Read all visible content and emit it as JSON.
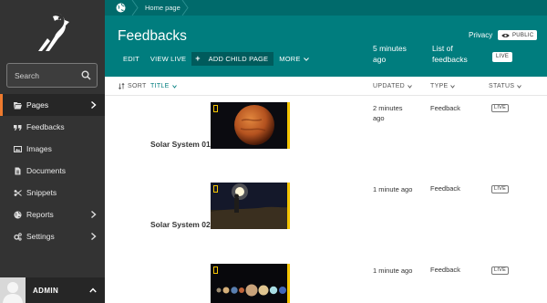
{
  "sidebar": {
    "search": {
      "placeholder": "Search"
    },
    "items": [
      {
        "label": "Pages",
        "icon": "folder-open-icon",
        "has_submenu": true,
        "active": true
      },
      {
        "label": "Feedbacks",
        "icon": "quote-icon",
        "has_submenu": false
      },
      {
        "label": "Images",
        "icon": "image-icon",
        "has_submenu": false
      },
      {
        "label": "Documents",
        "icon": "document-icon",
        "has_submenu": false
      },
      {
        "label": "Snippets",
        "icon": "snippet-icon",
        "has_submenu": false
      },
      {
        "label": "Reports",
        "icon": "globe-icon",
        "has_submenu": true
      },
      {
        "label": "Settings",
        "icon": "cogs-icon",
        "has_submenu": true
      }
    ],
    "account": {
      "name": "ADMIN"
    }
  },
  "header": {
    "breadcrumb": [
      "Home page"
    ],
    "title": "Feedbacks",
    "actions": {
      "edit": "EDIT",
      "view_live": "VIEW LIVE",
      "add_child": "ADD CHILD PAGE",
      "more": "MORE"
    },
    "privacy_label": "Privacy",
    "privacy_badge": "PUBLIC",
    "updated_line1": "5 minutes",
    "updated_line2": "ago",
    "subtitle_line1": "List of",
    "subtitle_line2": "feedbacks",
    "status_badge": "LIVE"
  },
  "table": {
    "sort_label": "SORT",
    "columns": {
      "title": "TITLE",
      "updated": "UPDATED",
      "type": "TYPE",
      "status": "STATUS"
    },
    "rows": [
      {
        "title": "Solar System 01",
        "updated_line1": "2 minutes",
        "updated_line2": "ago",
        "type": "Feedback",
        "status": "LIVE",
        "thumbnail": "mars-planet-image"
      },
      {
        "title": "Solar System 02",
        "updated_line1": "1 minute ago",
        "updated_line2": "",
        "type": "Feedback",
        "status": "LIVE",
        "thumbnail": "person-with-light-image"
      },
      {
        "title": "",
        "updated_line1": "1 minute ago",
        "updated_line2": "",
        "type": "Feedback",
        "status": "LIVE",
        "thumbnail": "planets-lineup-image"
      }
    ]
  },
  "colors": {
    "sidebar_bg": "#333333",
    "header_bg": "#007d7e",
    "breadcrumb_bg": "#006a6b",
    "active_accent": "#ee7a2e",
    "thumbnail_border": "#f4c400"
  }
}
